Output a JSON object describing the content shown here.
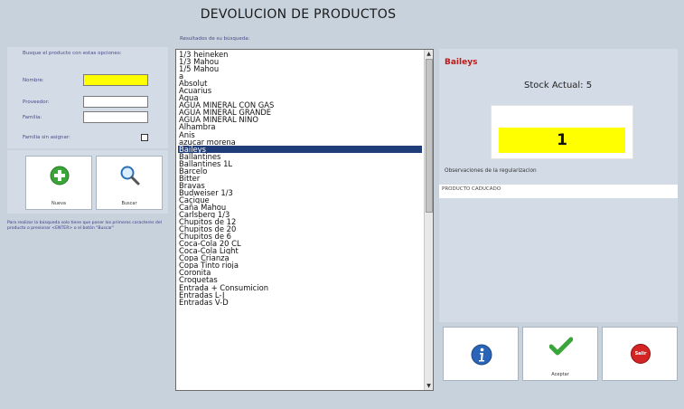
{
  "title": "DEVOLUCION DE PRODUCTOS",
  "search": {
    "hint": "Busque el producto con estas opciones:",
    "nombre_label": "Nombre:",
    "nombre_value": "",
    "proveedor_label": "Proveedor:",
    "proveedor_value": "",
    "familia_label": "Familia:",
    "familia_value": "",
    "sin_asignar_label": "Familia sin asignar:"
  },
  "buttons": {
    "nueva": "Nueva",
    "buscar": "Buscar",
    "aceptar": "Aceptar",
    "salir_icon_text": "Salir"
  },
  "help_text": "Para realizar la búsqueda solo tiene que poner los primeros caracteres del producto o presionar <ENTER> o el botón \"Buscar\"",
  "results": {
    "label": "Resultados de su búsqueda:",
    "selected_index": 17,
    "items": [
      "1/3 heineken",
      "1/3 Mahou",
      "1/5 Mahou",
      "a",
      "Absolut",
      "Acuarius",
      "Agua",
      "AGUA MINERAL CON GAS",
      "AGUA MINERAL GRANDE",
      "AGUA MINERAL NIÑO",
      "Alhambra",
      "Anis",
      "azucar morena",
      "Baileys",
      "Ballantines",
      "Ballantines 1L",
      "Barcelo",
      "Bitter",
      "Bravas",
      "Budweiser 1/3",
      "Cacique",
      "Caña Mahou",
      "Carlsberg 1/3",
      "Chupitos de 12",
      "Chupitos de 20",
      "Chupitos de 6",
      "Coca-Cola 20 CL",
      "Coca-Cola Light",
      "Copa Crianza",
      "Copa Tinto rioja",
      "Coronita",
      "Croquetas",
      "Entrada + Consumicion",
      "Entradas L-J",
      "Entradas V-D"
    ]
  },
  "detail": {
    "product_name": "Baileys",
    "stock_label": "Stock Actual: 5",
    "quantity": "1",
    "obs_label": "Observaciones de la regularizacion",
    "obs_value": "PRODUCTO CADUCADO"
  },
  "colors": {
    "background": "#c8d2dc",
    "panel": "#d3dce6",
    "highlight_field": "#ffff00",
    "selection": "#1f3d78",
    "product_name": "#c01818"
  },
  "icons": {
    "nueva": "plus-circle-icon",
    "buscar": "magnifier-icon",
    "info": "info-icon",
    "aceptar": "checkmark-icon",
    "salir": "stop-sign-icon"
  }
}
